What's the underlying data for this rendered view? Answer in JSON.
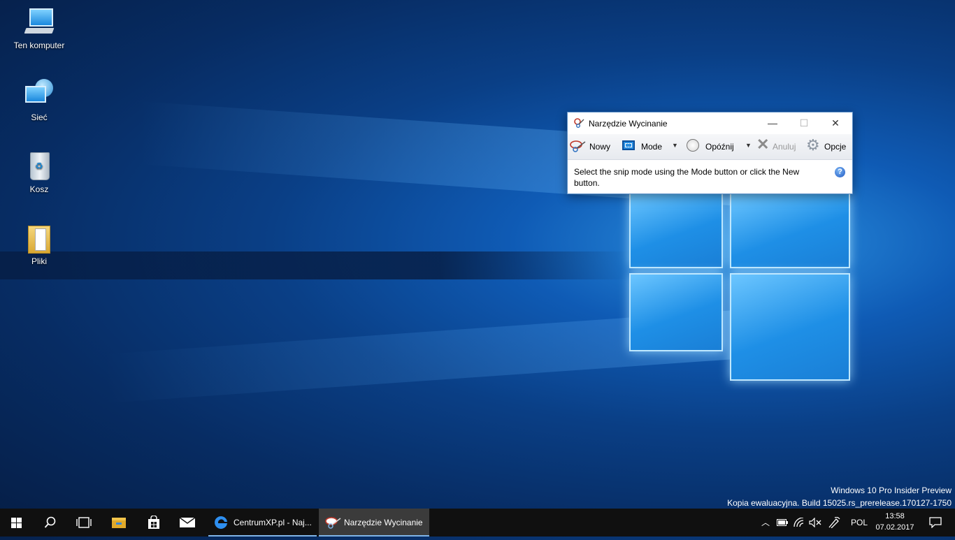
{
  "desktop": {
    "icons": [
      {
        "label": "Ten komputer"
      },
      {
        "label": "Sieć"
      },
      {
        "label": "Kosz"
      },
      {
        "label": "Pliki"
      }
    ]
  },
  "snipping_tool": {
    "title": "Narzędzie Wycinanie",
    "toolbar": {
      "new_label": "Nowy",
      "mode_label": "Mode",
      "delay_label": "Opóźnij",
      "cancel_label": "Anuluj",
      "options_label": "Opcje"
    },
    "message": "Select the snip mode using the Mode button or click the New button."
  },
  "watermark": {
    "line1": "Windows 10 Pro Insider Preview",
    "line2": "Kopia ewaluacyjna. Build 15025.rs_prerelease.170127-1750"
  },
  "taskbar": {
    "apps": [
      {
        "label": "CentrumXP.pl - Naj..."
      },
      {
        "label": "Narzędzie Wycinanie"
      }
    ],
    "tray": {
      "language": "POL",
      "time": "13:58",
      "date": "07.02.2017"
    }
  }
}
